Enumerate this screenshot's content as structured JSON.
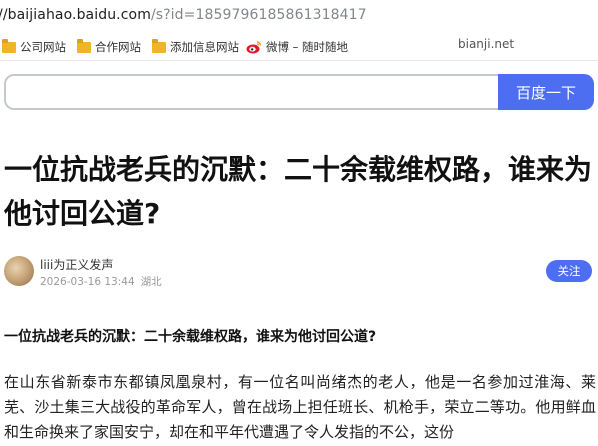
{
  "browser": {
    "url_host": "//baijiahao.baidu.com",
    "url_path": "/s?id=1859796185861318417"
  },
  "bookmarks": [
    {
      "label": "公司网站",
      "icon": "folder-icon"
    },
    {
      "label": "合作网站",
      "icon": "folder-icon"
    },
    {
      "label": "添加信息网站",
      "icon": "folder-icon"
    },
    {
      "label": "微博 – 随时随地",
      "icon": "weibo-icon"
    }
  ],
  "watermark": "bianji.net",
  "search": {
    "placeholder": "",
    "button_label": "百度一下"
  },
  "article": {
    "title": "一位抗战老兵的沉默：二十余载维权路，谁来为他讨回公道?",
    "author": "liii为正义发声",
    "timestamp": "2026-03-16 13:44",
    "location": "湖北",
    "follow_label": "关注",
    "subtitle": "一位抗战老兵的沉默：二十余载维权路，谁来为他讨回公道?",
    "body": "在山东省新泰市东都镇凤凰泉村，有一位名叫尚绪杰的老人，他是一名参加过淮海、莱芜、沙土集三大战役的革命军人，曾在战场上担任班长、机枪手，荣立二等功。他用鲜血和生命换来了家国安宁，却在和平年代遭遇了令人发指的不公，这份"
  },
  "colors": {
    "accent": "#4e6ef2",
    "folder": "#f0b429"
  }
}
